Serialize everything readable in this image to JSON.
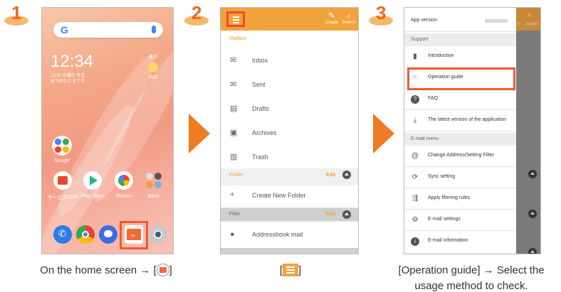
{
  "steps": [
    "1",
    "2",
    "3"
  ],
  "phone1": {
    "search_logo": "G",
    "time": "12:34",
    "date": "12/22 日曜日 冬至",
    "greeting": "おつかれさまです",
    "weather_region": "東京",
    "weather_day": "明日",
    "apps": [
      {
        "label": "Google"
      },
      {
        "label": "サービスTOP"
      },
      {
        "label": "Play Store"
      },
      {
        "label": "Photos"
      },
      {
        "label": "Basic"
      }
    ],
    "dock_mail_badge": "au"
  },
  "phone2": {
    "actions": [
      {
        "label": "Create",
        "glyph": "✎"
      },
      {
        "label": "Search",
        "glyph": "⌕"
      }
    ],
    "mailbox_title": "Mailbox",
    "mailboxes": [
      "Inbox",
      "Sent",
      "Drafts",
      "Archives",
      "Trash"
    ],
    "folder_title": "Folder",
    "edit_label": "Edit",
    "create_folder": "Create New Folder",
    "filter_title": "Filter",
    "filter_item": "Addressbook mail"
  },
  "phone3": {
    "app_version_label": "App version",
    "support_title": "Support",
    "support_items": [
      "Introduction",
      "Operation guide",
      "FAQ",
      "The latest version of the application"
    ],
    "email_menu_title": "E-mail menu",
    "email_items": [
      "Change Address/Setting Filter",
      "Sync setting",
      "Apply filtering rules",
      "E-mail settings",
      "E-mail information"
    ],
    "strip_labels": [
      "e",
      "Search"
    ]
  },
  "captions": {
    "c1_prefix": "On the home screen → [",
    "c1_suffix": "]",
    "c2_prefix": "[",
    "c2_suffix": "]",
    "c3": "[Operation guide] → Select the usage method to check."
  },
  "colors": {
    "accent": "#ef7b22",
    "highlight": "#ef5b2c",
    "header": "#f2a23a"
  }
}
